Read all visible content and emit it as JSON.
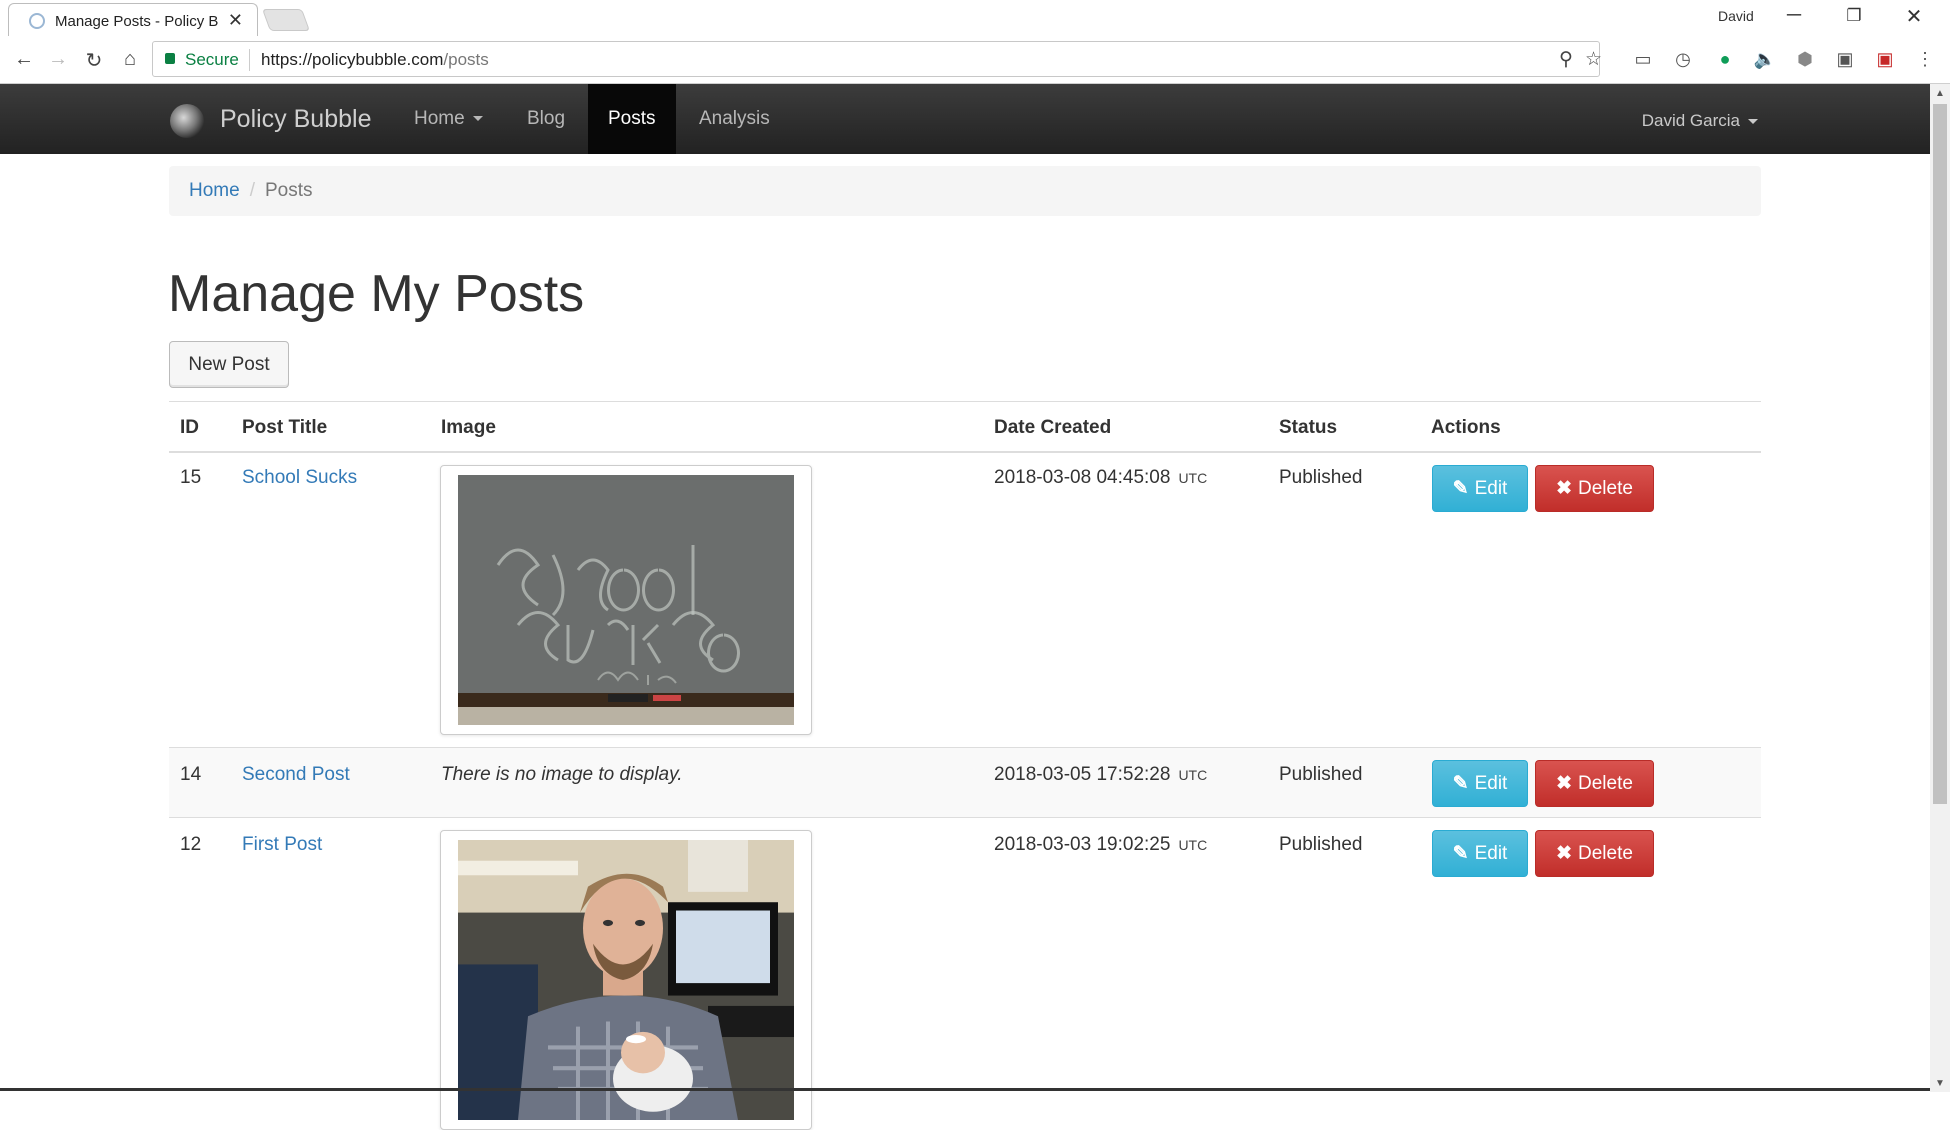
{
  "browser": {
    "tab_title": "Manage Posts - Policy Bu",
    "tab_close": "✕",
    "profile_name": "David",
    "secure_label": "Secure",
    "url_host": "https://policybubble.com",
    "url_path": "/posts",
    "minimize": "─",
    "restore": "❐",
    "close": "✕"
  },
  "navbar": {
    "brand": "Policy Bubble",
    "items": [
      {
        "label": "Home",
        "dropdown": true
      },
      {
        "label": "Blog"
      },
      {
        "label": "Posts",
        "active": true
      },
      {
        "label": "Analysis"
      }
    ],
    "user": "David Garcia"
  },
  "breadcrumb": {
    "home": "Home",
    "current": "Posts"
  },
  "page": {
    "title": "Manage My Posts",
    "new_post_label": "New Post"
  },
  "table": {
    "headers": [
      "ID",
      "Post Title",
      "Image",
      "Date Created",
      "Status",
      "Actions"
    ],
    "rows": [
      {
        "id": "15",
        "title": "School Sucks",
        "image": "chalkboard photo",
        "date": "2018-03-08 04:45:08",
        "tz": "UTC",
        "status": "Published"
      },
      {
        "id": "14",
        "title": "Second Post",
        "image_text": "There is no image to display.",
        "date": "2018-03-05 17:52:28",
        "tz": "UTC",
        "status": "Published"
      },
      {
        "id": "12",
        "title": "First Post",
        "image": "man holding baby photo",
        "date": "2018-03-03 19:02:25",
        "tz": "UTC",
        "status": "Published"
      }
    ],
    "edit_label": "Edit",
    "delete_label": "Delete"
  },
  "colors": {
    "navbar": "#222222",
    "link": "#337ab7",
    "edit": "#5bc0de",
    "delete": "#d9534f"
  }
}
